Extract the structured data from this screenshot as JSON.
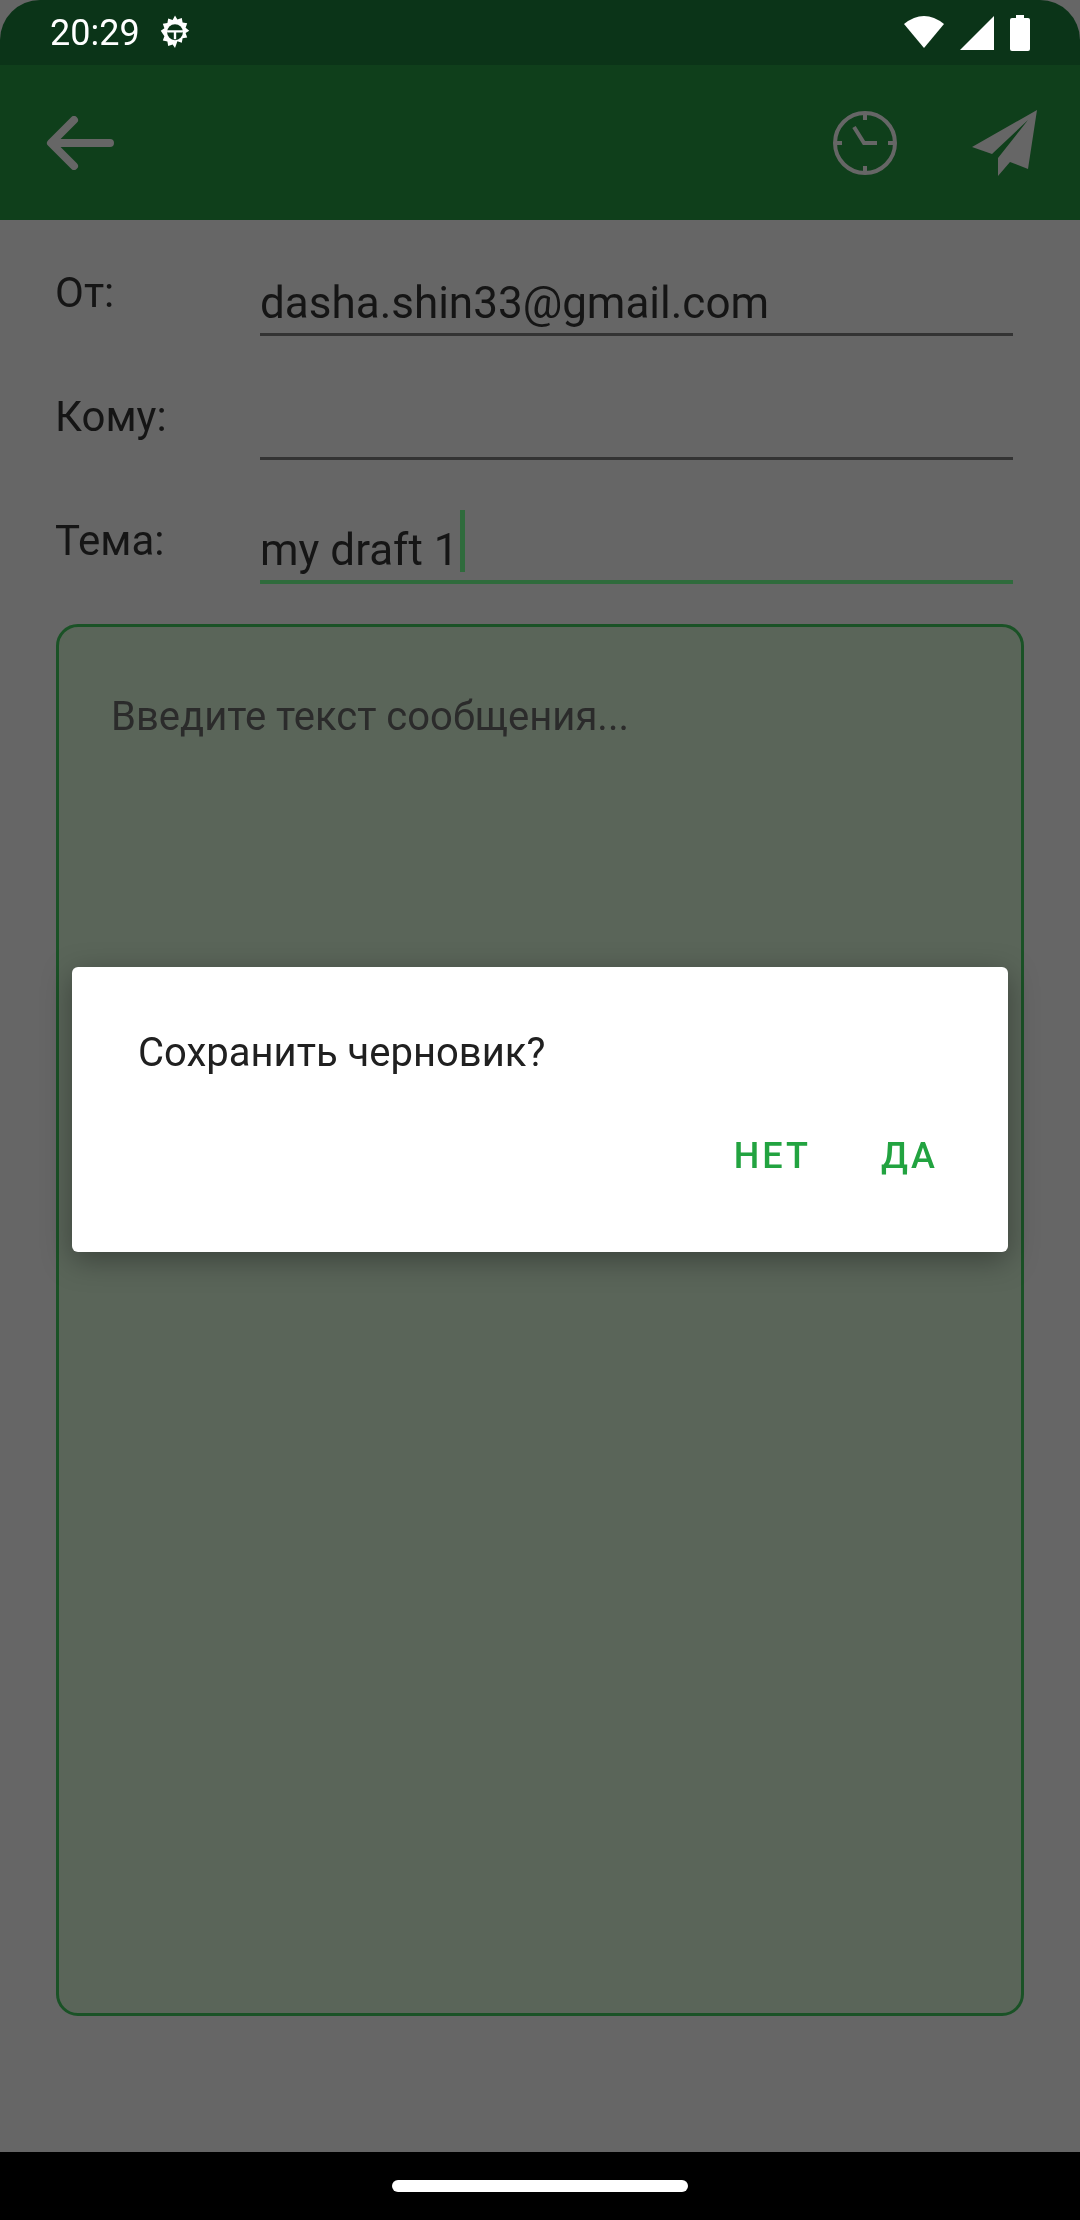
{
  "status_bar": {
    "time": "20:29"
  },
  "fields": [
    {
      "label": "От:",
      "value": "dasha.shin33@gmail.com",
      "focused": false
    },
    {
      "label": "Кому:",
      "focused": false
    },
    {
      "label": "Тема:",
      "value": "my draft 1",
      "focused": true
    }
  ],
  "message": {
    "placeholder": "Введите текст сообщения..."
  },
  "dialog": {
    "title": "Сохранить черновик?",
    "buttons": [
      "НЕТ",
      "ДА"
    ]
  }
}
